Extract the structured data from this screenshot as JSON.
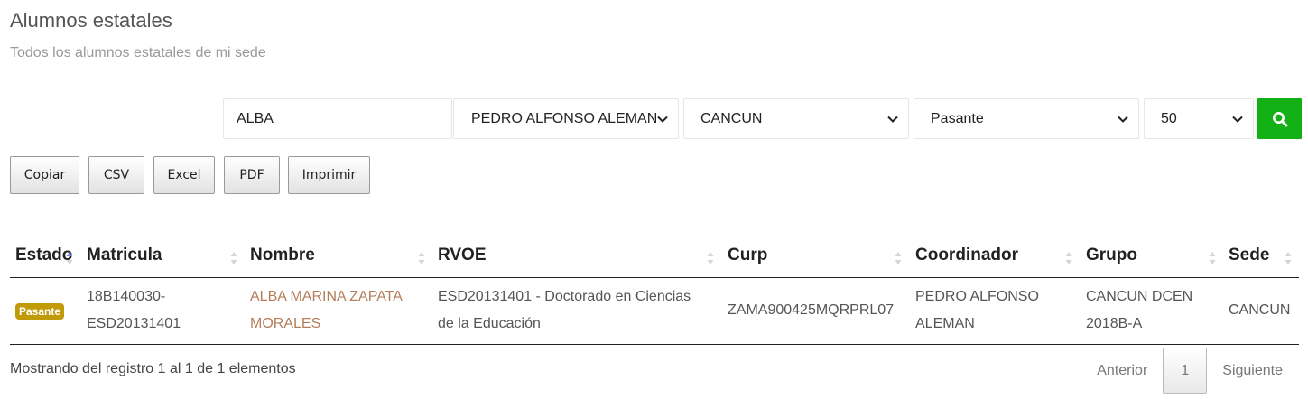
{
  "header": {
    "title": "Alumnos estatales",
    "subtitle": "Todos los alumnos estatales de mi sede"
  },
  "filters": {
    "search_value": "ALBA",
    "coordinator": "PEDRO ALFONSO ALEMAN",
    "sede": "CANCUN",
    "status": "Pasante",
    "page_size": "50",
    "search_icon": "search-icon",
    "search_color": "#13b016"
  },
  "export_buttons": {
    "copy": "Copiar",
    "csv": "CSV",
    "excel": "Excel",
    "pdf": "PDF",
    "print": "Imprimir"
  },
  "table": {
    "columns": [
      "Estado",
      "Matricula",
      "Nombre",
      "RVOE",
      "Curp",
      "Coordinador",
      "Grupo",
      "Sede"
    ],
    "rows": [
      {
        "estado": "Pasante",
        "matricula_1": "18B140030-",
        "matricula_2": "ESD20131401",
        "nombre_1": "ALBA MARINA ZAPATA",
        "nombre_2": "MORALES",
        "rvoe_1": "ESD20131401 - Doctorado en Ciencias",
        "rvoe_2": "de la Educación",
        "curp": "ZAMA900425MQRPRL07",
        "coordinador_1": "PEDRO ALFONSO",
        "coordinador_2": "ALEMAN",
        "grupo_1": "CANCUN DCEN",
        "grupo_2": "2018B-A",
        "sede": "CANCUN"
      }
    ],
    "badge_color": "#c09a07",
    "link_color": "#b57d5a"
  },
  "footer": {
    "info": "Mostrando del registro 1 al 1 de 1 elementos",
    "previous": "Anterior",
    "current_page": "1",
    "next": "Siguiente"
  }
}
